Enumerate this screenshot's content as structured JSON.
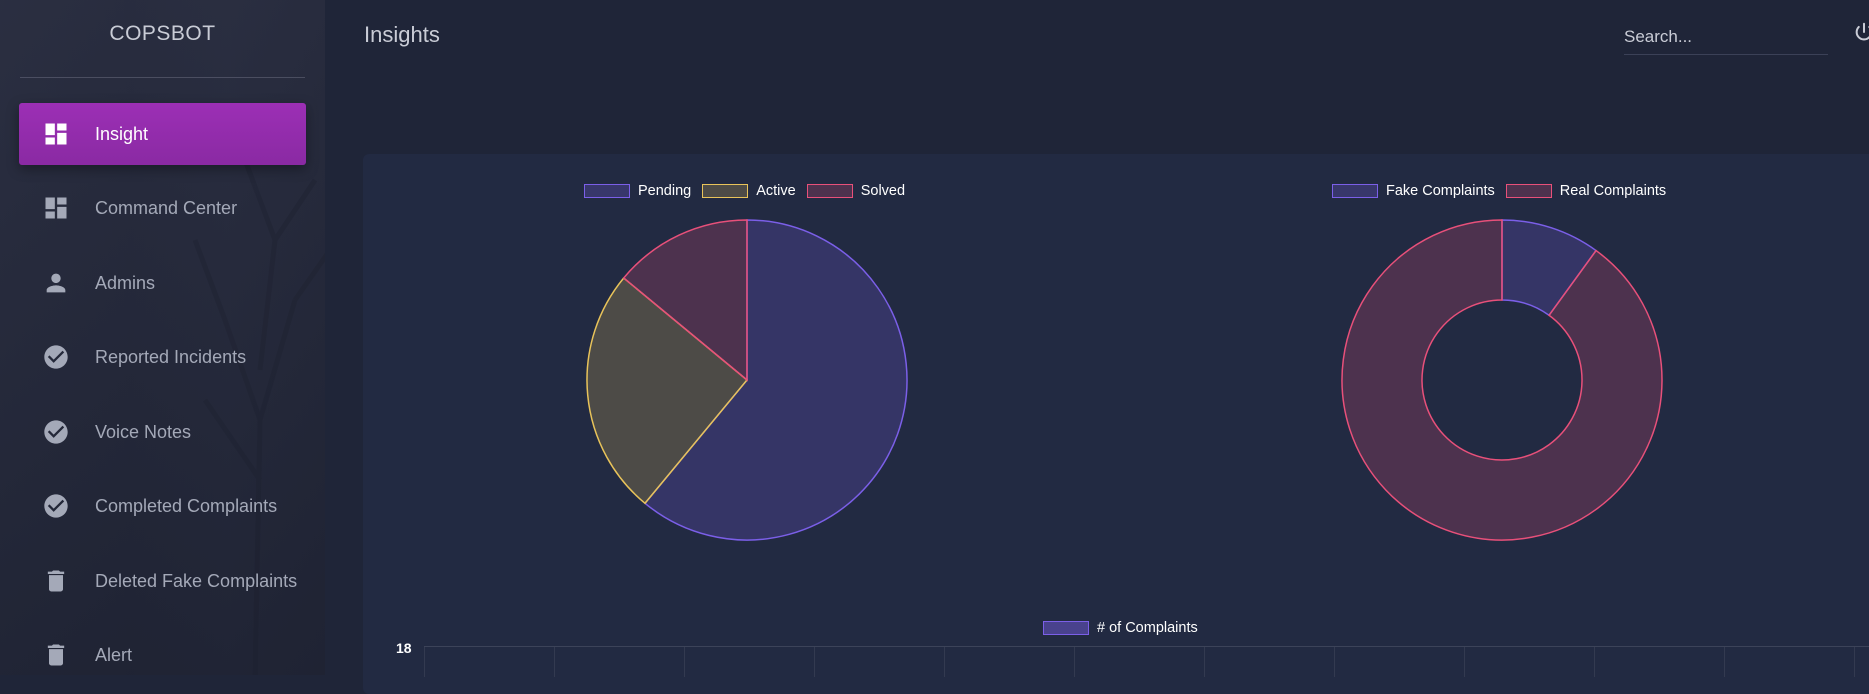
{
  "app": {
    "brand": "COPSBOT"
  },
  "sidebar": {
    "items": [
      {
        "label": "Insight",
        "icon": "dashboard-icon",
        "active": true
      },
      {
        "label": "Command Center",
        "icon": "dashboard-icon",
        "active": false
      },
      {
        "label": "Admins",
        "icon": "person-icon",
        "active": false
      },
      {
        "label": "Reported Incidents",
        "icon": "check-circle-icon",
        "active": false
      },
      {
        "label": "Voice Notes",
        "icon": "check-circle-icon",
        "active": false
      },
      {
        "label": "Completed Complaints",
        "icon": "check-circle-icon",
        "active": false
      },
      {
        "label": "Deleted Fake Complaints",
        "icon": "trash-icon",
        "active": false
      },
      {
        "label": "Alert",
        "icon": "trash-icon",
        "active": false
      }
    ]
  },
  "header": {
    "title": "Insights",
    "search_placeholder": "Search...",
    "power_icon": "power-icon"
  },
  "colors": {
    "accent": "#9c2fb5",
    "purple": "#7b5fe8",
    "yellow": "#e8c35a",
    "red": "#e8507a",
    "background": "#1f2538",
    "card": "#222a42"
  },
  "chart_data": [
    {
      "type": "pie",
      "labels": [
        "Pending",
        "Active",
        "Solved"
      ],
      "values": [
        61,
        25,
        14
      ],
      "colors": [
        "#7b5fe8",
        "#e8c35a",
        "#e8507a"
      ],
      "legend": "top"
    },
    {
      "type": "pie",
      "variant": "doughnut",
      "labels": [
        "Fake Complaints",
        "Real Complaints"
      ],
      "values": [
        10,
        90
      ],
      "colors": [
        "#7b5fe8",
        "#e8507a"
      ],
      "legend": "top"
    },
    {
      "type": "bar",
      "series": [
        {
          "name": "# of Complaints",
          "values": []
        }
      ],
      "yticks": [
        "18"
      ],
      "legend": "top"
    }
  ]
}
